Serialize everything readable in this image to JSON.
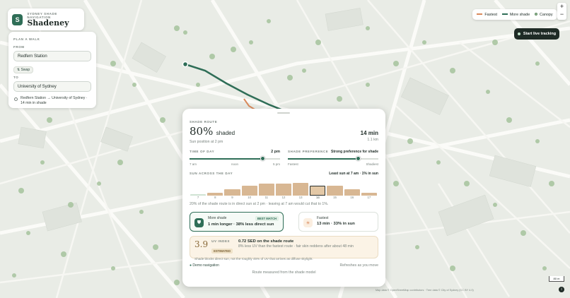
{
  "brand": {
    "logo_letter": "S",
    "tag": "SYDNEY SHADE NAVIGATION",
    "name": "Shadeney"
  },
  "plan": {
    "heading": "PLAN A WALK",
    "from_label": "FROM",
    "from_value": "Redfern Station",
    "swap_label": "Swap",
    "to_label": "TO",
    "to_value": "University of Sydney",
    "recent": "Redfern Station → University of Sydney · 14 min in shade"
  },
  "legend": {
    "fastest": "Fastest",
    "more_shade": "More shade",
    "canopy": "Canopy",
    "colors": {
      "fastest": "#d98a5c",
      "more_shade": "#2f6e57",
      "canopy": "#9fbf9a"
    }
  },
  "zoom": {
    "in": "+",
    "out": "−"
  },
  "live_button": "Start live tracking",
  "sheet": {
    "eyebrow": "SHADE ROUTE",
    "shaded_pct": "80%",
    "shaded_word": "shaded",
    "sun_position": "Sun position at 2 pm",
    "duration": "14 min",
    "distance": "1.1 km",
    "time_label": "TIME OF DAY",
    "time_value": "2 pm",
    "time_fraction": 0.81,
    "time_ticks": [
      "7 am",
      "noon",
      "5 pm"
    ],
    "pref_label": "SHADE PREFERENCE",
    "pref_value": "Strong preference for shade",
    "pref_fraction": 0.78,
    "pref_ticks": [
      "Fastest",
      "Shadiest"
    ],
    "sun_label": "SUN ACROSS THE DAY",
    "least_sun": "Least sun at 7 am · 1% in sun",
    "hours": [
      "7",
      "8",
      "9",
      "10",
      "11",
      "12",
      "13",
      "14",
      "15",
      "16",
      "17"
    ],
    "sun_note": "20% of the shade route is in direct sun at 2 pm · leaving at 7 am would cut that to 1%.",
    "more_shade": {
      "title": "More shade",
      "detail": "1 min longer · 38% less direct sun",
      "badge": "BEST MATCH"
    },
    "fastest": {
      "title": "Fastest",
      "detail": "13 min · 33% in sun"
    },
    "uv": {
      "value": "3.9",
      "index_label": "UV INDEX",
      "estimated": "ESTIMATED",
      "headline": "0.72 SED on the shade route",
      "sub": "8% less UV than the fastest route · fair skin reddens after about 48 min",
      "note": "Shade blocks direct sun, not the roughly 45% of UV that arrives as diffuse skylight."
    },
    "demo": "Demo navigation",
    "refresh": "Refreshes as you move",
    "footer": "Route measured from the shade model"
  },
  "attribution": "Map data © OpenStreetMap contributors · Tree data © City of Sydney (CC BY 4.0)",
  "scale": "80 m",
  "chart_data": {
    "type": "bar",
    "title": "SUN ACROSS THE DAY",
    "categories": [
      "7",
      "8",
      "9",
      "10",
      "11",
      "12",
      "13",
      "14",
      "15",
      "16",
      "17"
    ],
    "values": [
      1,
      5,
      12,
      20,
      23,
      23,
      25,
      20,
      20,
      13,
      5
    ],
    "selected": "14"
  }
}
